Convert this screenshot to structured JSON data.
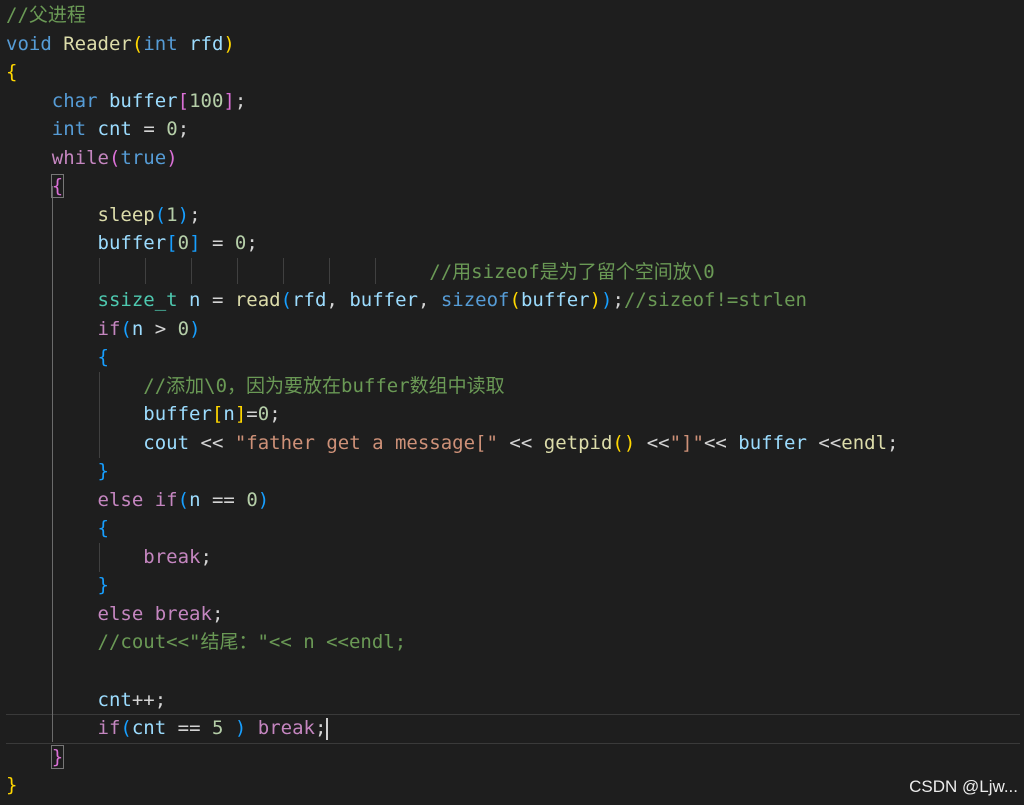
{
  "watermark": "CSDN @Ljw...",
  "code": {
    "l1_comment": "//父进程",
    "l2_void": "void",
    "l2_fn": "Reader",
    "l2_int": "int",
    "l2_param": "rfd",
    "l4_char": "char",
    "l4_var": "buffer",
    "l4_num": "100",
    "l5_int": "int",
    "l5_var": "cnt",
    "l5_num": "0",
    "l6_while": "while",
    "l6_true": "true",
    "l8_fn": "sleep",
    "l8_num": "1",
    "l9_var": "buffer",
    "l9_idx": "0",
    "l9_num": "0",
    "l10_comment": "//用sizeof是为了留个空间放\\0",
    "l11_type": "ssize_t",
    "l11_var": "n",
    "l11_fn": "read",
    "l11_arg1": "rfd",
    "l11_arg2": "buffer",
    "l11_sizeof": "sizeof",
    "l11_arg3": "buffer",
    "l11_comment": "//sizeof!=strlen",
    "l12_if": "if",
    "l12_var": "n",
    "l12_num": "0",
    "l14_comment": "//添加\\0，因为要放在buffer数组中读取",
    "l15_var": "buffer",
    "l15_idx": "n",
    "l15_num": "0",
    "l16_cout": "cout",
    "l16_str1": "\"father get a message[\"",
    "l16_fn": "getpid",
    "l16_str2": "\"]\"",
    "l16_buffer": "buffer",
    "l16_endl": "endl",
    "l18_else": "else",
    "l18_if": "if",
    "l18_var": "n",
    "l18_num": "0",
    "l20_break": "break",
    "l22_else": "else",
    "l22_break": "break",
    "l23_comment": "//cout<<\"结尾：\"<< n <<endl;",
    "l25_var": "cnt",
    "l26_if": "if",
    "l26_var": "cnt",
    "l26_num": "5",
    "l26_break": "break"
  }
}
